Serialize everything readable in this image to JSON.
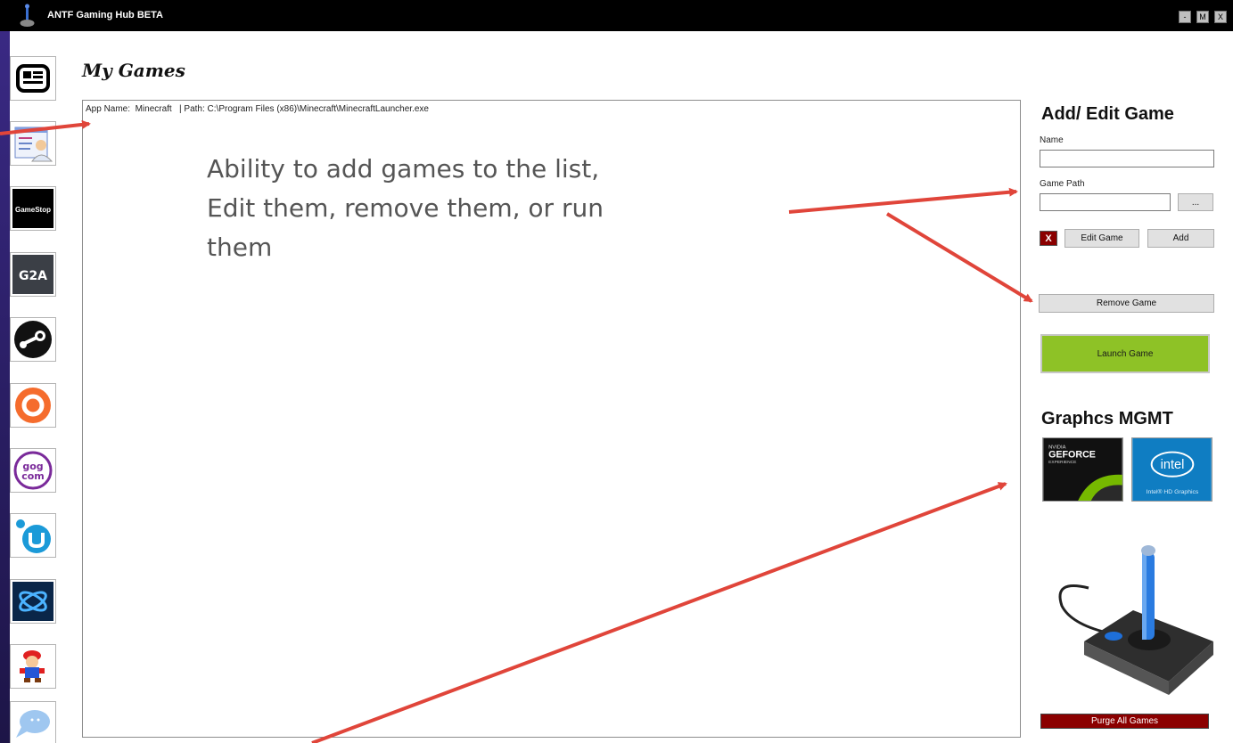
{
  "window": {
    "title": "ANTF Gaming Hub BETA",
    "controls": {
      "minimize": "-",
      "maximize": "M",
      "close": "X"
    }
  },
  "sidebar": {
    "items": [
      {
        "icon": "news-icon",
        "label": "News"
      },
      {
        "icon": "profile-icon",
        "label": "Profile"
      },
      {
        "icon": "gamestop-icon",
        "label": "GameStop",
        "text": "GameStop"
      },
      {
        "icon": "g2a-icon",
        "label": "G2A",
        "text": "G2A"
      },
      {
        "icon": "steam-icon",
        "label": "Steam"
      },
      {
        "icon": "origin-icon",
        "label": "Origin"
      },
      {
        "icon": "gog-icon",
        "label": "GOG",
        "text_top": "gog",
        "text_bottom": "com"
      },
      {
        "icon": "uplay-icon",
        "label": "Uplay"
      },
      {
        "icon": "battlenet-icon",
        "label": "Battle.net"
      },
      {
        "icon": "mario-icon",
        "label": "Mario"
      },
      {
        "icon": "chat-icon",
        "label": "Chat"
      }
    ]
  },
  "main": {
    "title": "My Games",
    "list_items": [
      "App Name:  Minecraft   | Path: C:\\Program Files (x86)\\Minecraft\\MinecraftLauncher.exe"
    ]
  },
  "annotation": {
    "lines": [
      "Ability to add games to the list,",
      "Edit them, remove them, or run",
      "them"
    ],
    "color": "#555555",
    "arrow_color": "#e0453a"
  },
  "edit_panel": {
    "heading": "Add/ Edit Game",
    "name_label": "Name",
    "name_value": "",
    "path_label": "Game Path",
    "path_value": "",
    "browse_label": "...",
    "delete_label": "X",
    "edit_label": "Edit Game",
    "add_label": "Add",
    "remove_label": "Remove Game",
    "launch_label": "Launch Game",
    "launch_color": "#8ec226"
  },
  "graphics_panel": {
    "heading": "Graphcs MGMT",
    "nvidia": {
      "line1": "NVIDIA",
      "line2": "GEFORCE",
      "line3": "EXPERIENCE"
    },
    "intel": {
      "logo": "intel",
      "caption": "Intel® HD Graphics"
    }
  },
  "purge_label": "Purge All Games",
  "purge_color": "#8b0000"
}
